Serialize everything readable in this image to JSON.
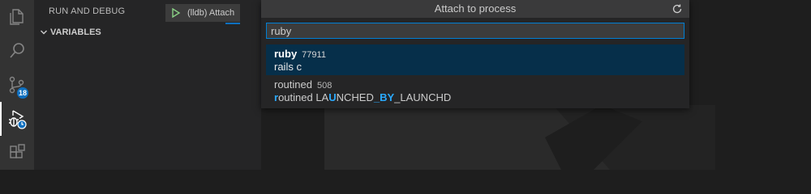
{
  "activity_bar": {
    "scm_badge": "18"
  },
  "sidebar": {
    "title": "RUN AND DEBUG",
    "launch_config": "(lldb) Attach",
    "section": "VARIABLES"
  },
  "quick_pick": {
    "title": "Attach to process",
    "input_value": "ruby",
    "items": [
      {
        "name_match": "ruby",
        "name_rest": "",
        "pid": "77911",
        "detail": "rails c",
        "selected": true
      },
      {
        "name": "routined",
        "pid": "508",
        "detail_parts": [
          "r",
          "outined LA",
          "U",
          "NCHED",
          "_BY",
          "_LAUNCHD"
        ]
      }
    ]
  },
  "colors": {
    "accent": "#007fd4",
    "highlight": "#2aaaff",
    "selection": "#062f4a"
  }
}
